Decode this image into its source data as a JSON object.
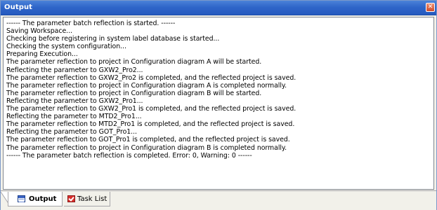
{
  "window": {
    "title": "Output",
    "close_glyph": "✕"
  },
  "log": {
    "lines": [
      "------ The parameter batch reflection is started. ------",
      "Saving Workspace...",
      "Checking before registering in system label database is started...",
      "Checking the system configuration...",
      "Preparing Execution...",
      "The parameter reflection to project in Configuration diagram A will be started.",
      "Reflecting the parameter to GXW2_Pro2...",
      "The parameter reflection to GXW2_Pro2 is completed, and the reflected project is saved.",
      "The parameter reflection to project in Configuration diagram A is completed normally.",
      "The parameter reflection to project in Configuration diagram B will be started.",
      "Reflecting the parameter to GXW2_Pro1...",
      "The parameter reflection to GXW2_Pro1 is completed, and the reflected project is saved.",
      "Reflecting the parameter to MTD2_Pro1...",
      "The parameter reflection to MTD2_Pro1 is completed, and the reflected project is saved.",
      "Reflecting the parameter to GOT_Pro1...",
      "The parameter reflection to GOT_Pro1 is completed, and the reflected project is saved.",
      "The parameter reflection to project in Configuration diagram B is completed normally.",
      "------ The parameter batch reflection is completed. Error: 0, Warning: 0 ------"
    ]
  },
  "tabs": [
    {
      "label": "Output",
      "icon": "output-window-icon",
      "active": true
    },
    {
      "label": "Task List",
      "icon": "task-list-check-icon",
      "active": false
    }
  ],
  "colors": {
    "titlebar": "#2f66c9",
    "close_button": "#d9532f",
    "pane_background": "#ffffff",
    "frame": "#f2f1ea"
  }
}
